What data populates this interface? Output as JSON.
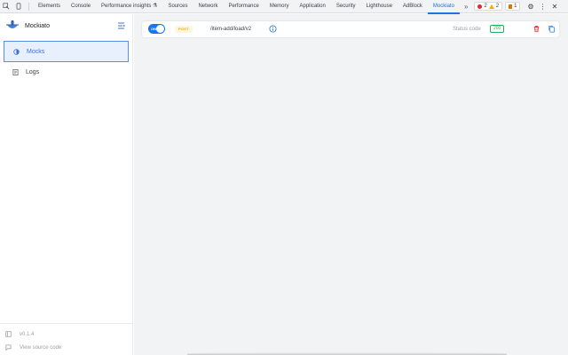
{
  "devtools": {
    "tabs": [
      {
        "label": "Elements"
      },
      {
        "label": "Console"
      },
      {
        "label": "Performance insights ⚗"
      },
      {
        "label": "Sources"
      },
      {
        "label": "Network"
      },
      {
        "label": "Performance"
      },
      {
        "label": "Memory"
      },
      {
        "label": "Application"
      },
      {
        "label": "Security"
      },
      {
        "label": "Lighthouse"
      },
      {
        "label": "AdBlock"
      },
      {
        "label": "Mockiato"
      }
    ],
    "active_tab": "Mockiato",
    "overflow_label": "»",
    "error_count": "2",
    "warning_count": "2",
    "issue_count": "1",
    "settings_glyph": "⚙",
    "more_glyph": "⋮",
    "close_glyph": "✕"
  },
  "sidebar": {
    "app_name": "Mockiato",
    "logo_icon": "mockiato-logo-icon",
    "items": [
      {
        "label": "Mocks",
        "icon": "mocks-icon",
        "active": true
      },
      {
        "label": "Logs",
        "icon": "logs-icon",
        "active": false
      }
    ],
    "footer": {
      "version": "v0.1.4",
      "source_link": "View source code"
    }
  },
  "mock": {
    "enabled_label": "ON",
    "method": "POST",
    "path": "/item-add/load/v2",
    "status_label": "Status code",
    "status_code": "200"
  },
  "colors": {
    "accent": "#1a73e8",
    "method_post": "#f2a600",
    "status_ok": "#34a853",
    "delete": "#d93025",
    "main_bg": "#f1f3f4"
  }
}
